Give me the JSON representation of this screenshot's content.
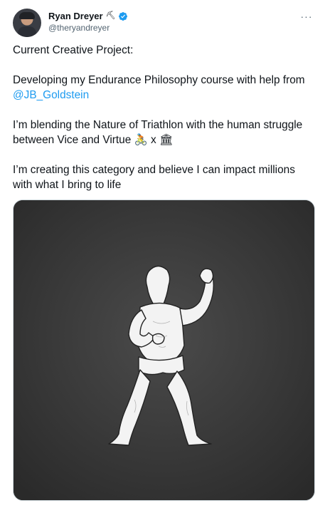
{
  "author": {
    "display_name": "Ryan Dreyer",
    "name_emoji": "⛏",
    "handle": "@theryandreyer"
  },
  "more_menu": "···",
  "tweet": {
    "line1": "Current Creative Project:",
    "line2_text": "Developing my Endurance Philosophy course with help from ",
    "mention": "@JB_Goldstein",
    "line3_text": "I’m blending the Nature of Triathlon with the human struggle between Vice and Virtue ",
    "line3_emoji_bike": "🚴",
    "line3_x": " x ",
    "line3_emoji_temple": "🏛",
    "line4": "I’m creating this category and believe I can impact millions with what I bring to life"
  },
  "media": {
    "description_icon": "boxer-illustration",
    "background_color": "#3b3b3b",
    "figure_color": "#f2f2f2"
  },
  "colors": {
    "link": "#1d9bf0",
    "verified": "#1d9bf0",
    "secondary_text": "#536471"
  }
}
